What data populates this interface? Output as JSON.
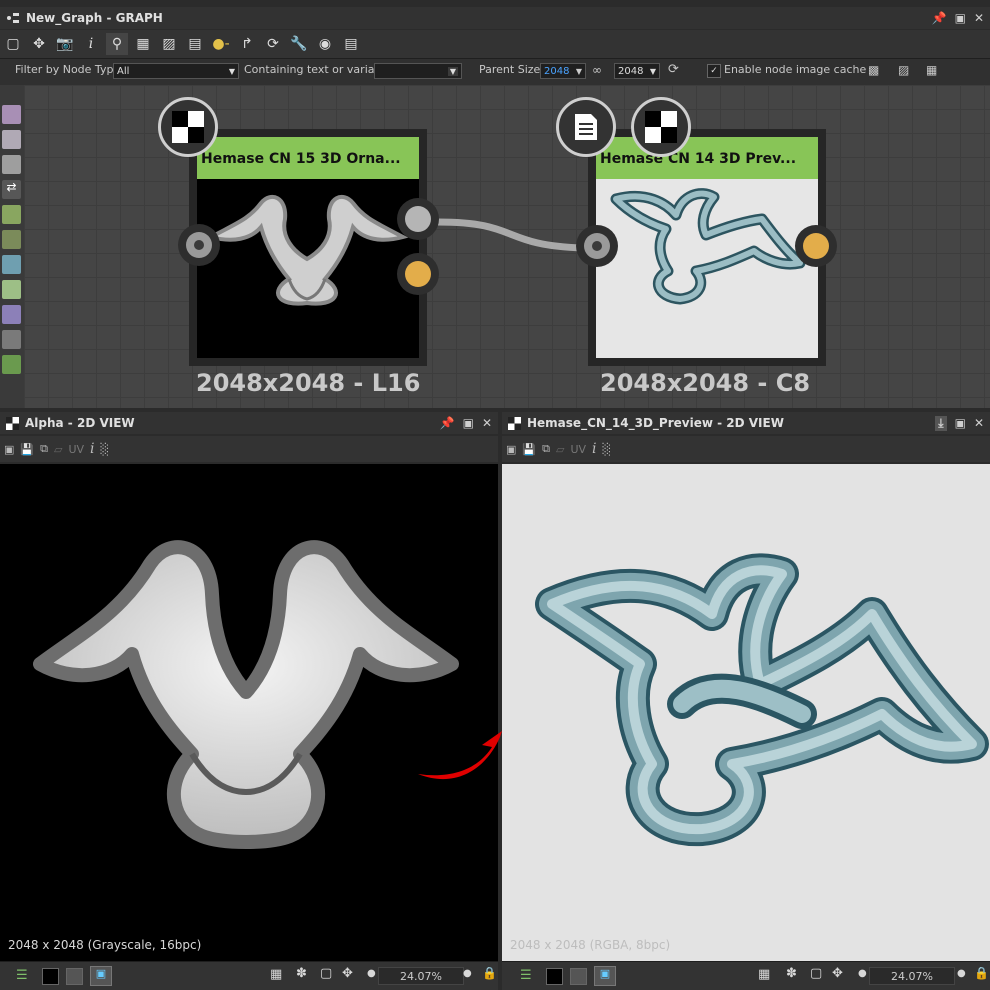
{
  "graph_panel": {
    "title": "New_Graph - GRAPH"
  },
  "filter": {
    "filter_label": "Filter by Node Type",
    "filter_value": "All",
    "containing_label": "Containing text or variable",
    "parent_size_label": "Parent Size:",
    "parent_size_value": "2048",
    "parent_size_value2": "2048",
    "cache_label": "Enable node image cache",
    "cache_checked": true
  },
  "nodes": [
    {
      "title": "Hemase CN 15 3D Orna...",
      "resolution": "2048x2048 - L16",
      "header_color": "#88c557"
    },
    {
      "title": "Hemase CN 14 3D Prev...",
      "resolution": "2048x2048 - C8",
      "header_color": "#88c557"
    }
  ],
  "view_left": {
    "title": "Alpha - 2D VIEW",
    "uv_label": "UV",
    "info": "2048 x 2048 (Grayscale, 16bpc)",
    "zoom": "24.07%"
  },
  "view_right": {
    "title": "Hemase_CN_14_3D_Preview - 2D VIEW",
    "uv_label": "UV",
    "info": "2048 x 2048 (RGBA, 8bpc)",
    "zoom": "24.07%"
  },
  "colors": {
    "node_header": "#88c557",
    "output_port": "#e3ad4a",
    "parent_size_accent": "#4aa3ff",
    "arrow": "#e00000",
    "ornament_3d": "#8fb5bd"
  }
}
